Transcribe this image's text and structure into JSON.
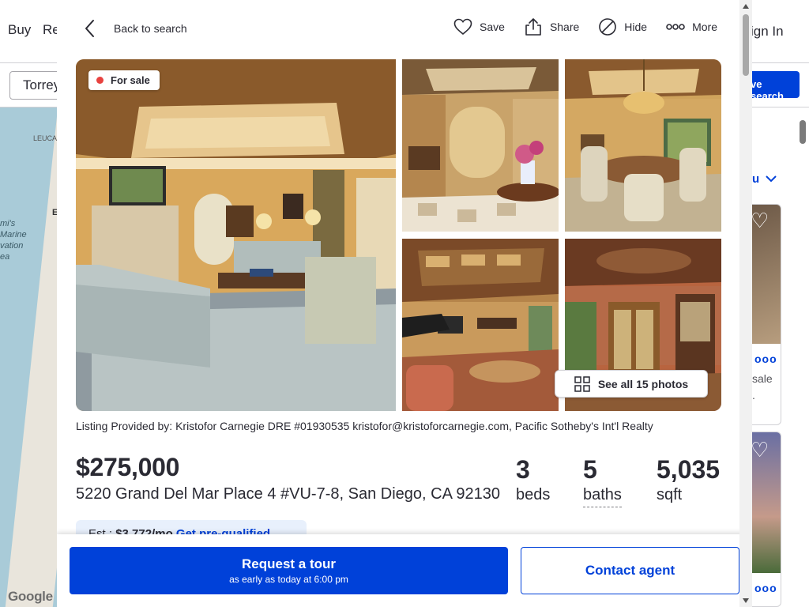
{
  "background": {
    "nav": [
      "Buy",
      "Re"
    ],
    "sign_in": "ign In",
    "search_value": "Torrey",
    "save_search": "ve search",
    "right_text": "u",
    "card_text_1": "sale",
    "card_text_2": ".",
    "map_labels": [
      "LEUCA",
      "mi's\nMarine\nvation\nea",
      "E"
    ],
    "google": "Google"
  },
  "topbar": {
    "back_label": "Back to search",
    "actions": [
      {
        "label": "Save",
        "icon": "heart-icon"
      },
      {
        "label": "Share",
        "icon": "share-icon"
      },
      {
        "label": "Hide",
        "icon": "hide-icon"
      },
      {
        "label": "More",
        "icon": "more-icon"
      }
    ]
  },
  "gallery": {
    "badge": "For sale",
    "see_all": "See all 15 photos",
    "photos": [
      "living-room",
      "entry-foyer",
      "dining-room",
      "great-room",
      "library"
    ]
  },
  "listing": {
    "provided_by": "Listing Provided by: Kristofor Carnegie DRE #01930535 kristofor@kristoforcarnegie.com, Pacific Sotheby's Int'l Realty",
    "price": "$275,000",
    "address": "5220 Grand Del Mar Place 4 #VU-7-8, San Diego, CA 92130",
    "beds_value": "3",
    "beds_label": "beds",
    "baths_value": "5",
    "baths_label": "baths",
    "sqft_value": "5,035",
    "sqft_label": "sqft",
    "est_label": "Est.:",
    "est_payment": "$3,772/mo",
    "prequalify": "Get pre-qualified"
  },
  "cta": {
    "tour_title": "Request a tour",
    "tour_subtitle": "as early as today at 6:00 pm",
    "contact": "Contact agent"
  },
  "colors": {
    "primary": "#0041d9",
    "badge_dot": "#e8423f",
    "text": "#2a2a33"
  }
}
